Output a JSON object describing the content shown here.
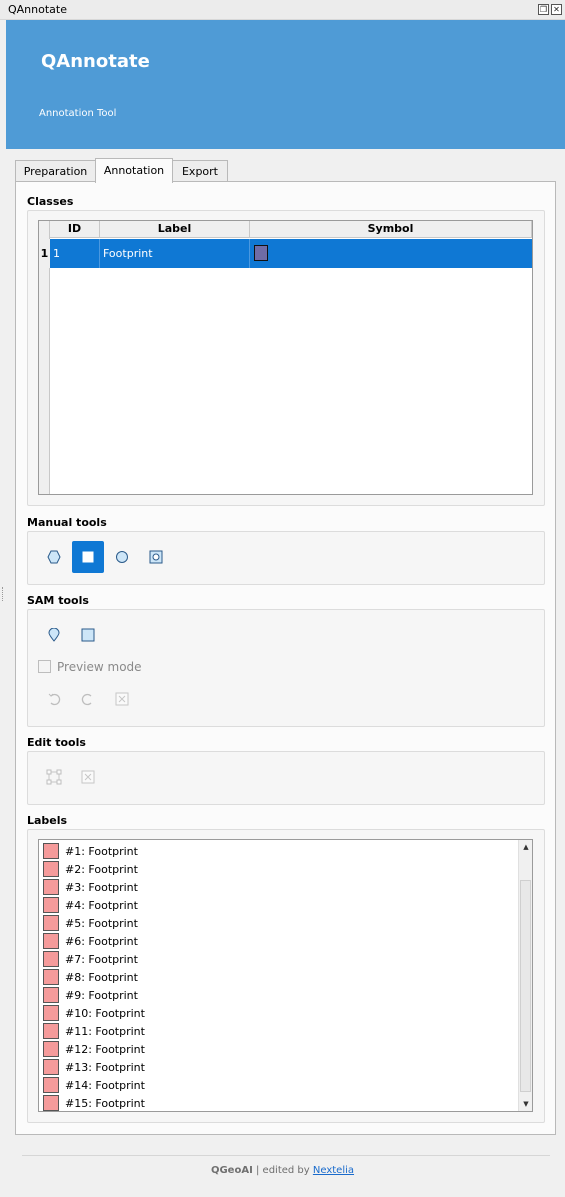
{
  "window": {
    "title": "QAnnotate"
  },
  "banner": {
    "title": "QAnnotate",
    "subtitle": "Annotation Tool"
  },
  "tabs": [
    {
      "label": "Preparation"
    },
    {
      "label": "Annotation",
      "active": true
    },
    {
      "label": "Export"
    }
  ],
  "classes": {
    "section_label": "Classes",
    "headers": {
      "id": "ID",
      "label": "Label",
      "symbol": "Symbol"
    },
    "rows": [
      {
        "row_number": "1",
        "id": "1",
        "label": "Footprint",
        "symbol_color": "#6f6ca6"
      }
    ]
  },
  "manual_tools": {
    "section_label": "Manual tools",
    "tools": [
      "polygon-icon",
      "rectangle-icon",
      "circle-icon",
      "donut-icon"
    ],
    "selected": "rectangle-icon"
  },
  "sam_tools": {
    "section_label": "SAM tools",
    "tools": [
      "point-icon",
      "box-icon"
    ],
    "preview_label": "Preview mode",
    "preview_checked": false,
    "actions": [
      "undo-icon",
      "redo-icon",
      "clear-icon"
    ]
  },
  "edit_tools": {
    "section_label": "Edit tools",
    "tools": [
      "vertex-edit-icon",
      "delete-icon"
    ]
  },
  "labels": {
    "section_label": "Labels",
    "swatch_color": "#f59b9b",
    "items": [
      "#1: Footprint",
      "#2: Footprint",
      "#3: Footprint",
      "#4: Footprint",
      "#5: Footprint",
      "#6: Footprint",
      "#7: Footprint",
      "#8: Footprint",
      "#9: Footprint",
      "#10: Footprint",
      "#11: Footprint",
      "#12: Footprint",
      "#13: Footprint",
      "#14: Footprint",
      "#15: Footprint"
    ]
  },
  "footer": {
    "brand": "QGeoAI",
    "separator": "|",
    "edited_by": "edited by",
    "link": "Nextelia"
  },
  "colors": {
    "banner": "#4f9bd6",
    "accent": "#0f78d4"
  }
}
